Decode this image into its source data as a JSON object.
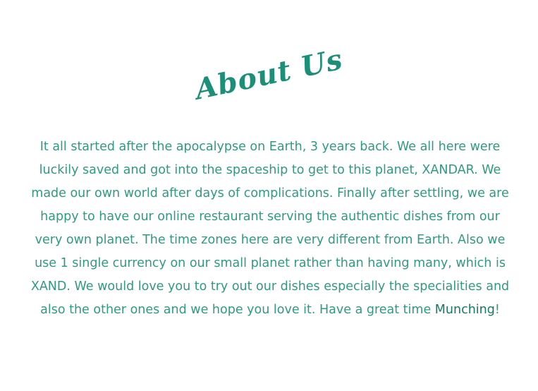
{
  "about": {
    "title": "About Us",
    "paragraph_before": "It all started after the apocalypse on Earth, 3 years back. We all here were luckily saved and got into the spaceship to get to this planet, XANDAR. We made our own world after days of complications. Finally after settling, we are happy to have our online restaurant serving the authentic dishes from our very own planet. The time zones here are very different from Earth. Also we use 1 single currency on our small planet rather than having many, which is XAND. We would love you to try out our dishes especially the specialities and also the other ones and we hope you love it. Have a great time ",
    "highlight": "Munching",
    "paragraph_after": "!"
  },
  "colors": {
    "accent": "#1b8f77",
    "text": "#2f9a82",
    "highlight": "#157a63"
  }
}
